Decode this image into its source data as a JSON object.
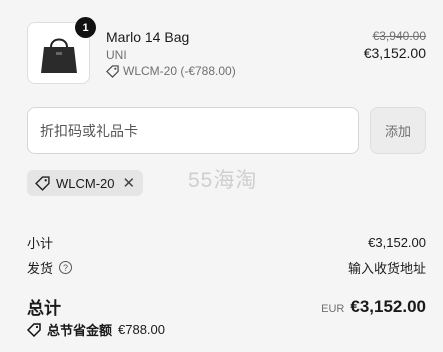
{
  "product": {
    "quantity": "1",
    "name": "Marlo 14 Bag",
    "variant": "UNI",
    "discount_tag": "WLCM-20 (-€788.00)",
    "price_original": "€3,940.00",
    "price_final": "€3,152.00",
    "thumbnail_icon": "handbag-icon"
  },
  "discount_form": {
    "placeholder": "折扣码或礼品卡",
    "apply_label": "添加"
  },
  "applied_code": {
    "label": "WLCM-20",
    "tag_icon": "tag-icon",
    "remove_icon": "close-icon"
  },
  "watermark": "55海淘",
  "summary": {
    "subtotal_label": "小计",
    "subtotal_value": "€3,152.00",
    "shipping_label": "发货",
    "shipping_value": "输入收货地址",
    "total_label": "总计",
    "currency": "EUR",
    "total_value": "€3,152.00",
    "savings_label": "总节省金额",
    "savings_value": "€788.00"
  }
}
